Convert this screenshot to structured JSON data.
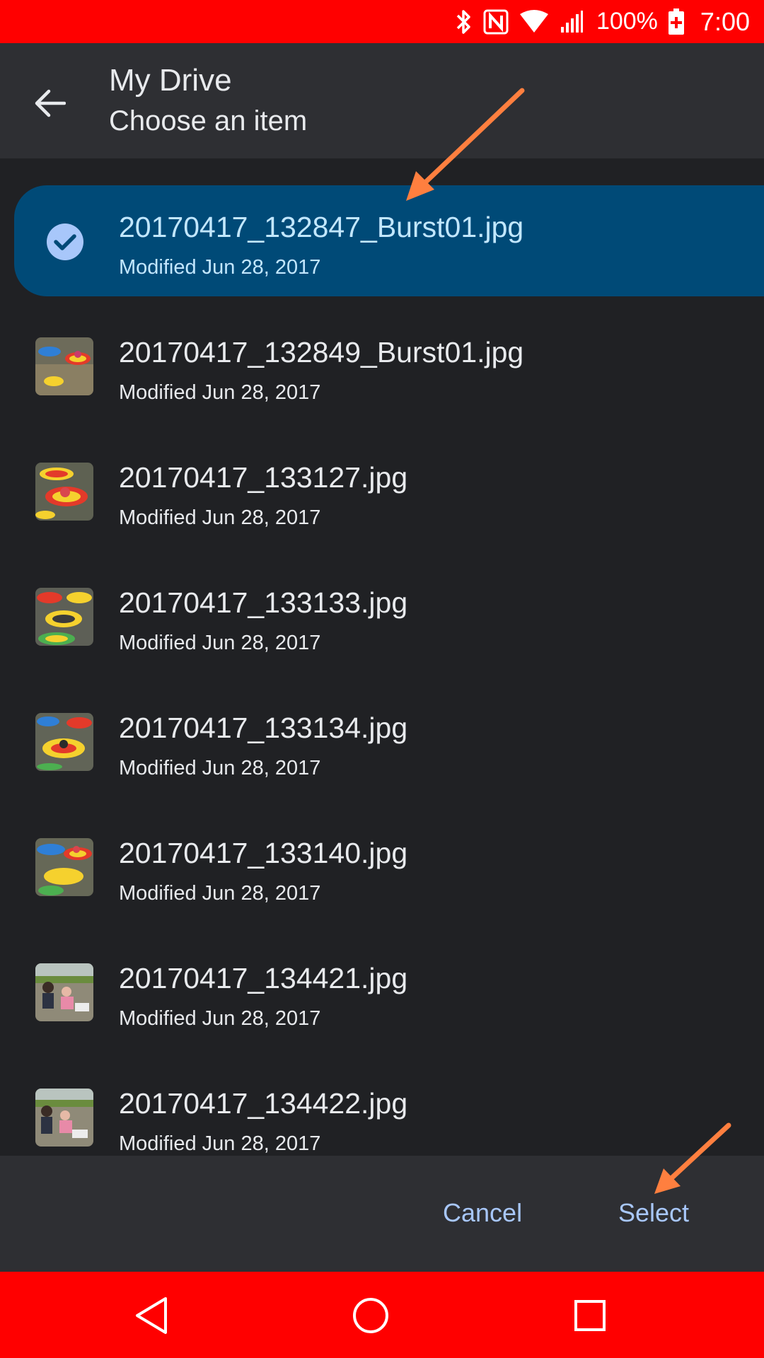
{
  "status_bar": {
    "battery_percent": "100%",
    "time": "7:00",
    "icons": [
      "bluetooth-icon",
      "nfc-icon",
      "wifi-icon",
      "signal-icon",
      "battery-charging-icon"
    ]
  },
  "app_bar": {
    "title": "My Drive",
    "subtitle": "Choose an item"
  },
  "files": [
    {
      "name": "20170417_132847_Burst01.jpg",
      "modified": "Modified Jun 28, 2017",
      "selected": true
    },
    {
      "name": "20170417_132849_Burst01.jpg",
      "modified": "Modified Jun 28, 2017",
      "selected": false
    },
    {
      "name": "20170417_133127.jpg",
      "modified": "Modified Jun 28, 2017",
      "selected": false
    },
    {
      "name": "20170417_133133.jpg",
      "modified": "Modified Jun 28, 2017",
      "selected": false
    },
    {
      "name": "20170417_133134.jpg",
      "modified": "Modified Jun 28, 2017",
      "selected": false
    },
    {
      "name": "20170417_133140.jpg",
      "modified": "Modified Jun 28, 2017",
      "selected": false
    },
    {
      "name": "20170417_134421.jpg",
      "modified": "Modified Jun 28, 2017",
      "selected": false
    },
    {
      "name": "20170417_134422.jpg",
      "modified": "Modified Jun 28, 2017",
      "selected": false
    }
  ],
  "actions": {
    "cancel_label": "Cancel",
    "select_label": "Select"
  },
  "colors": {
    "status_bar": "#ff0000",
    "selected_row": "#004a77",
    "accent_text": "#a8c7fa",
    "annotation_arrow": "#ff7f3f"
  }
}
